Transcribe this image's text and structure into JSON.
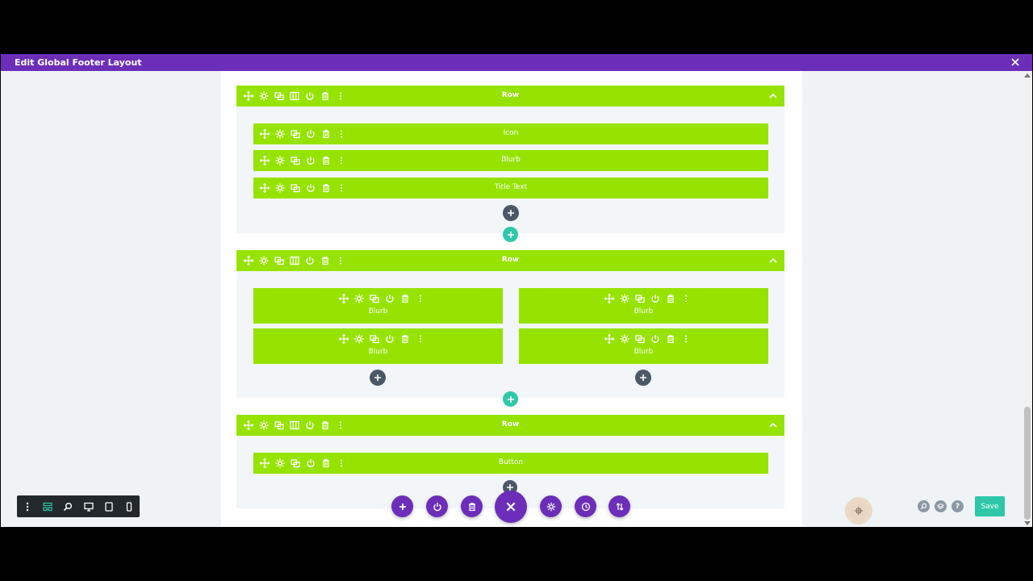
{
  "window": {
    "title": "Edit Global Footer Layout"
  },
  "rows": [
    {
      "label": "Row",
      "modules": [
        {
          "label": "Icon"
        },
        {
          "label": "Blurb"
        },
        {
          "label": "Title Text"
        }
      ]
    },
    {
      "label": "Row",
      "columns": [
        {
          "modules": [
            {
              "label": "Blurb"
            },
            {
              "label": "Blurb"
            }
          ]
        },
        {
          "modules": [
            {
              "label": "Blurb"
            },
            {
              "label": "Blurb"
            }
          ]
        }
      ]
    },
    {
      "label": "Row",
      "modules": [
        {
          "label": "Button"
        }
      ]
    }
  ],
  "bottom_bar": {
    "save_label": "Save",
    "help_label": "?"
  },
  "colors": {
    "titlebar": "#6c2eb9",
    "row_green": "#96e300",
    "teal": "#2ec8a9",
    "dark_plus": "#4c5866",
    "purple_fab": "#6c2eb9"
  },
  "icons": {
    "row_tools": [
      "move-icon",
      "gear-icon",
      "duplicate-icon",
      "columns-icon",
      "power-icon",
      "trash-icon",
      "more-icon"
    ],
    "module_tools": [
      "move-icon",
      "gear-icon",
      "duplicate-icon",
      "power-icon",
      "trash-icon",
      "more-icon"
    ],
    "left_toolbar": [
      "more-icon",
      "wireframe-icon",
      "zoom-icon",
      "desktop-icon",
      "tablet-icon",
      "phone-icon"
    ],
    "fabs": [
      "add-icon",
      "power-icon",
      "trash-icon",
      "close-icon",
      "gear-icon",
      "history-icon",
      "sort-icon"
    ]
  }
}
